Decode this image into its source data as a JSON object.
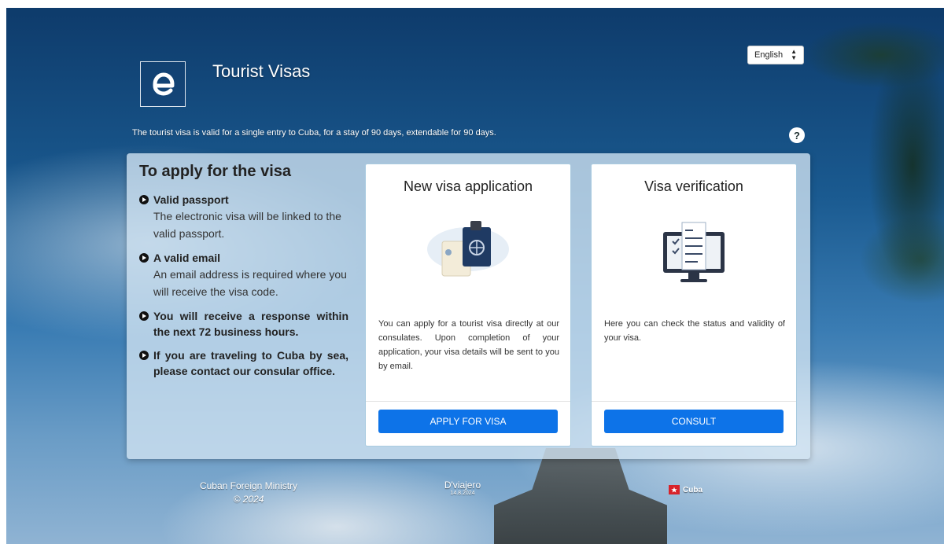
{
  "language": {
    "selected": "English"
  },
  "header": {
    "title": "Tourist Visas",
    "subtitle": "The tourist visa is valid for a single entry to Cuba, for a stay of 90 days, extendable for 90 days.",
    "help_label": "?"
  },
  "requirements": {
    "heading": "To apply for the visa",
    "items": [
      {
        "title": "Valid passport",
        "body": "The electronic visa will be linked to the valid passport."
      },
      {
        "title": "A valid email",
        "body": "An email address is required where you will receive the visa code."
      },
      {
        "title": "You will receive a response within the next 72 business hours.",
        "body": ""
      },
      {
        "title": "If you are traveling to Cuba by sea, please contact our consular office.",
        "body": ""
      }
    ]
  },
  "cards": {
    "apply": {
      "title": "New visa application",
      "description": "You can apply for a tourist visa directly at our consulates. Upon completion of your application, your visa details will be sent to you by email.",
      "button": "APPLY FOR VISA"
    },
    "verify": {
      "title": "Visa verification",
      "description": "Here you can check the status and validity of your visa.",
      "button": "CONSULT"
    }
  },
  "footer": {
    "ministry": "Cuban Foreign Ministry",
    "year": "© 2024",
    "app_name": "D'viajero",
    "version": "14.8.2024",
    "country": "Cuba"
  },
  "colors": {
    "primary_button": "#0d73e8",
    "title_text": "#ffffff"
  }
}
